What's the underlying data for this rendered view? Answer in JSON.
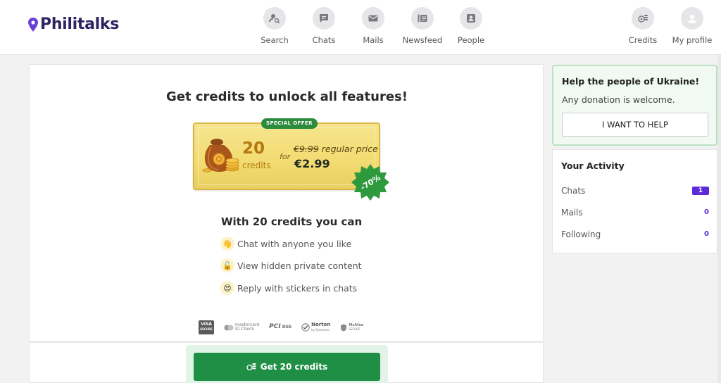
{
  "header": {
    "logo": "Philitalks",
    "nav": [
      {
        "label": "Search",
        "icon": "search-user-icon"
      },
      {
        "label": "Chats",
        "icon": "chat-bubble-icon"
      },
      {
        "label": "Mails",
        "icon": "envelope-icon"
      },
      {
        "label": "Newsfeed",
        "icon": "newsfeed-icon"
      },
      {
        "label": "People",
        "icon": "person-card-icon"
      }
    ],
    "right": [
      {
        "label": "Credits",
        "icon": "coins-icon"
      },
      {
        "label": "My profile",
        "icon": "avatar-icon"
      }
    ]
  },
  "main": {
    "title": "Get credits to unlock all features!",
    "offer": {
      "tag": "SPECIAL OFFER",
      "credits": "20",
      "credits_word": "credits",
      "for_word": "for",
      "old_price": "€9.99",
      "old_price_suffix": " regular price",
      "new_price": "€2.99",
      "discount": "-70%"
    },
    "can_title": "With 20 credits you can",
    "features": [
      {
        "text": "Chat with anyone you like",
        "icon": "waving-hand-icon"
      },
      {
        "text": "View hidden private content",
        "icon": "unlock-icon"
      },
      {
        "text": "Reply with stickers in chats",
        "icon": "heart-eyes-icon"
      }
    ],
    "payments": {
      "visa": "VISA",
      "visa_sub": "SECURE",
      "mastercard": "mastercard",
      "mastercard_sub": "ID Check",
      "pci": "PCI",
      "pci_sub": "DSS",
      "norton": "Norton",
      "norton_sub": "by Symantec",
      "mcafee": "McAfee",
      "mcafee_sub": "SECURE"
    },
    "button": "Get 20 credits"
  },
  "sidebar": {
    "ukraine": {
      "title": "Help the people of Ukraine!",
      "subtitle": "Any donation is welcome.",
      "button": "I WANT TO HELP"
    },
    "activity": {
      "title": "Your Activity",
      "rows": [
        {
          "label": "Chats",
          "count": "1"
        },
        {
          "label": "Mails",
          "count": "0"
        },
        {
          "label": "Following",
          "count": "0"
        }
      ]
    }
  },
  "colors": {
    "brand": "#2d2361",
    "cta_green": "#1e8f44",
    "badge_purple": "#5b2bd9",
    "gold": "#b5780f"
  }
}
